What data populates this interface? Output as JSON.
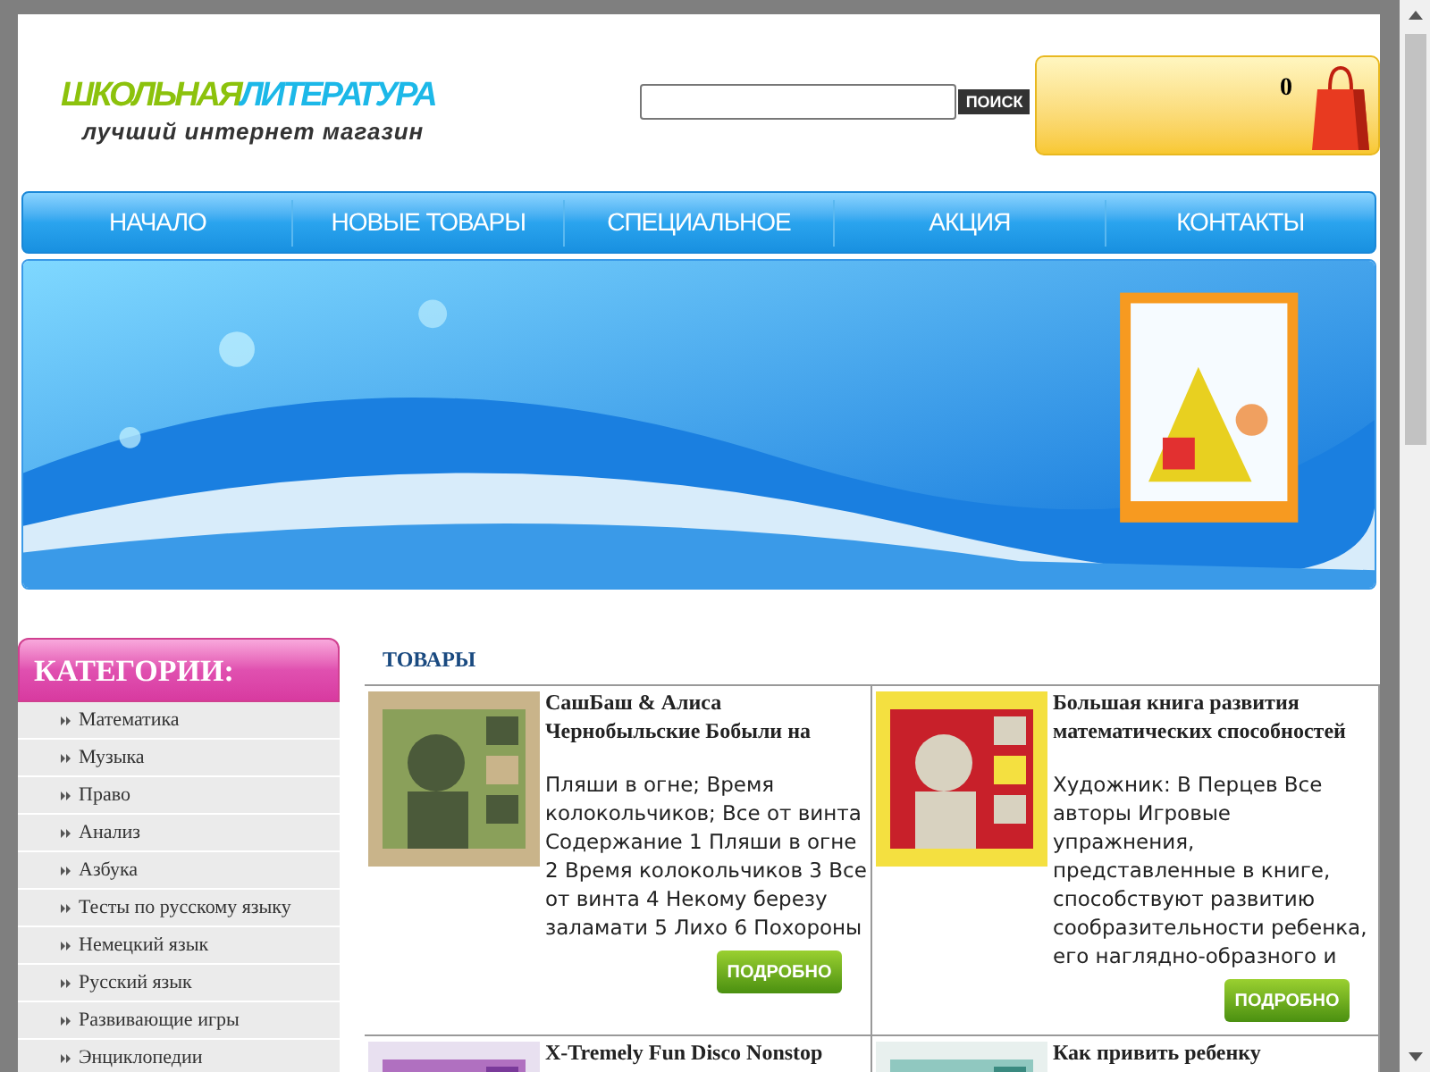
{
  "header": {
    "logo_parts": [
      "ШКОЛЬНАЯ",
      "ЛИТЕРАТУРА"
    ],
    "tagline": "лучший интернет магазин",
    "search_button": "ПОИСК",
    "cart_count": "0"
  },
  "nav": [
    "НАЧАЛО",
    "НОВЫЕ ТОВАРЫ",
    "СПЕЦИАЛЬНОЕ",
    "АКЦИЯ",
    "КОНТАКТЫ"
  ],
  "sidebar": {
    "title": "КАТЕГОРИИ:",
    "items": [
      "Математика",
      "Музыка",
      "Право",
      "Анализ",
      "Азбука",
      "Тесты по русскому языку",
      "Немецкий язык",
      "Русский язык",
      "Развивающие игры",
      "Энциклопедии"
    ]
  },
  "products": {
    "title": "ТОВАРЫ",
    "items": [
      {
        "title": "СашБаш & Алиса Чернобыльские Бобыли на",
        "description": "Пляши в огне; Время колокольчиков; Все от винта Содержание 1 Пляши в огне 2 Время колокольчиков 3 Все от винта 4 Некому березу заламати 5 Лихо 6 Похороны",
        "button": "ПОДРОБНО"
      },
      {
        "title": "Большая книга развития математических способностей",
        "description": "Художник: В Перцев Все авторы Игровые упражнения, представленные в книге, способствуют развитию сообразительности ребенка, его наглядно-образного и",
        "button": "ПОДРОБНО"
      },
      {
        "title": "X-Tremely Fun Disco Nonstop"
      },
      {
        "title": "Как привить ребенку"
      }
    ]
  }
}
